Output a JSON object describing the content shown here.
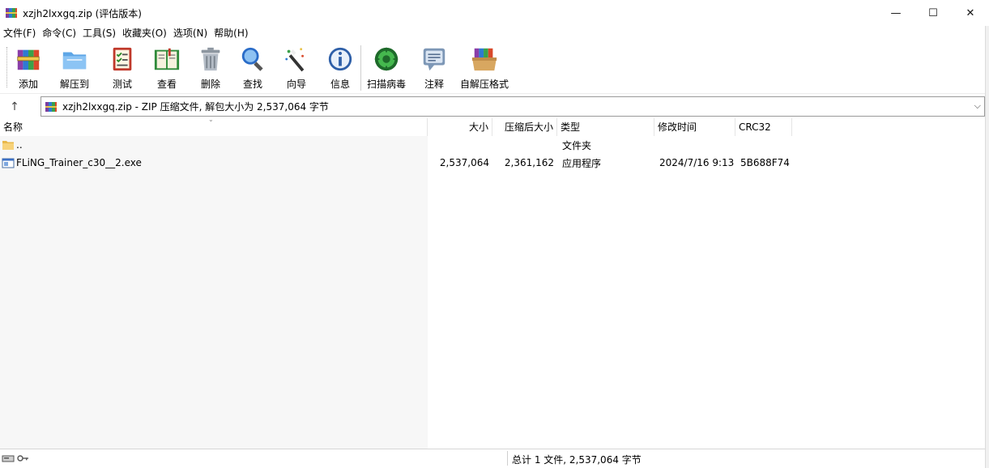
{
  "window": {
    "title": "xzjh2lxxgq.zip (评估版本)",
    "controls": {
      "minimize": "—",
      "maximize": "☐",
      "close": "✕"
    }
  },
  "menu": [
    "文件(F)",
    "命令(C)",
    "工具(S)",
    "收藏夹(O)",
    "选项(N)",
    "帮助(H)"
  ],
  "toolbar": [
    {
      "label": "添加",
      "icon": "add-archive-icon"
    },
    {
      "label": "解压到",
      "icon": "extract-folder-icon"
    },
    {
      "label": "测试",
      "icon": "test-checklist-icon"
    },
    {
      "label": "查看",
      "icon": "view-book-icon"
    },
    {
      "label": "删除",
      "icon": "delete-trash-icon"
    },
    {
      "label": "查找",
      "icon": "find-magnifier-icon"
    },
    {
      "label": "向导",
      "icon": "wizard-wand-icon"
    },
    {
      "label": "信息",
      "icon": "info-icon"
    },
    {
      "label": "扫描病毒",
      "icon": "virus-scan-icon"
    },
    {
      "label": "注释",
      "icon": "comment-icon"
    },
    {
      "label": "自解压格式",
      "icon": "sfx-box-icon"
    }
  ],
  "address": {
    "up": "↑",
    "text": "xzjh2lxxgq.zip - ZIP 压缩文件, 解包大小为 2,537,064 字节",
    "dropdown": "⌵"
  },
  "columns": {
    "name": "名称",
    "size": "大小",
    "packed": "压缩后大小",
    "type": "类型",
    "modified": "修改时间",
    "crc": "CRC32"
  },
  "files": [
    {
      "name": "..",
      "size": "",
      "packed": "",
      "type": "文件夹",
      "modified": "",
      "crc": "",
      "icon": "folder-icon"
    },
    {
      "name": "FLiNG_Trainer_c30__2.exe",
      "size": "2,537,064",
      "packed": "2,361,162",
      "type": "应用程序",
      "modified": "2024/7/16 9:13",
      "crc": "5B688F74",
      "icon": "exe-file-icon"
    }
  ],
  "status": {
    "summary": "总计 1 文件, 2,537,064 字节"
  },
  "colors": {
    "accent": "#c63e2e",
    "border": "#9a9a9a"
  }
}
